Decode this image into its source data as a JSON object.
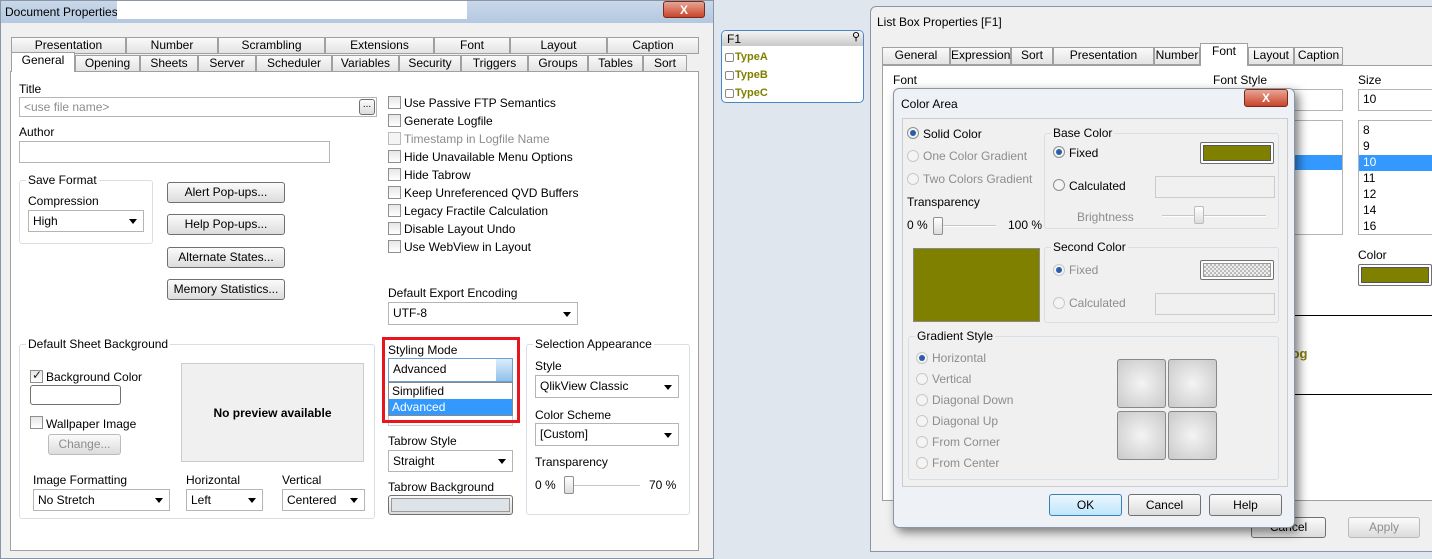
{
  "doc": {
    "title": "Document Properties",
    "close": "X",
    "tabs_row1": [
      "Presentation",
      "Number",
      "Scrambling",
      "Extensions",
      "Font",
      "Layout",
      "Caption"
    ],
    "tabs_row2": [
      "General",
      "Opening",
      "Sheets",
      "Server",
      "Scheduler",
      "Variables",
      "Security",
      "Triggers",
      "Groups",
      "Tables",
      "Sort"
    ],
    "title_label": "Title",
    "title_placeholder": "<use file name>",
    "browse": "...",
    "author_label": "Author",
    "save_format": "Save Format",
    "compression_label": "Compression",
    "compression": "High",
    "buttons": [
      "Alert Pop-ups...",
      "Help Pop-ups...",
      "Alternate States...",
      "Memory Statistics..."
    ],
    "checks": [
      {
        "label": "Use Passive FTP Semantics",
        "checked": false,
        "disabled": false
      },
      {
        "label": "Generate Logfile",
        "checked": false,
        "disabled": false
      },
      {
        "label": "Timestamp in Logfile Name",
        "checked": false,
        "disabled": true
      },
      {
        "label": "Hide Unavailable Menu Options",
        "checked": false,
        "disabled": false
      },
      {
        "label": "Hide Tabrow",
        "checked": false,
        "disabled": false
      },
      {
        "label": "Keep Unreferenced QVD Buffers",
        "checked": false,
        "disabled": false
      },
      {
        "label": "Legacy Fractile Calculation",
        "checked": false,
        "disabled": false
      },
      {
        "label": "Disable Layout Undo",
        "checked": false,
        "disabled": false
      },
      {
        "label": "Use WebView in Layout",
        "checked": false,
        "disabled": false
      }
    ],
    "export_label": "Default Export Encoding",
    "export": "UTF-8",
    "sheet_bg": "Default Sheet Background",
    "bg_color": "Background Color",
    "wallpaper": "Wallpaper Image",
    "change": "Change...",
    "no_preview": "No preview available",
    "img_fmt_label": "Image Formatting",
    "img_fmt": "No Stretch",
    "horiz_label": "Horizontal",
    "horiz": "Left",
    "vert_label": "Vertical",
    "vert": "Centered",
    "styling_label": "Styling Mode",
    "styling": "Advanced",
    "styling_options": [
      "Simplified",
      "Advanced"
    ],
    "tabrow_style_label": "Tabrow Style",
    "tabrow_style": "Straight",
    "tabrow_bg_label": "Tabrow Background",
    "sel_app": "Selection Appearance",
    "style_label": "Style",
    "style": "QlikView Classic",
    "scheme_label": "Color Scheme",
    "scheme": "[Custom]",
    "transp_label": "Transparency",
    "transp_min": "0 %",
    "transp_max": "70 %",
    "transp_value": 0
  },
  "listbox": {
    "title": "F1",
    "search_icon": "search-icon",
    "items": [
      "TypeA",
      "TypeB",
      "TypeC"
    ],
    "item_color": "#7f7f00"
  },
  "lbp": {
    "title": "List Box Properties [F1]",
    "tabs": [
      "General",
      "Expressions",
      "Sort",
      "Presentation",
      "Number",
      "Font",
      "Layout",
      "Caption"
    ],
    "font_label": "Font",
    "style_label": "Font Style",
    "size_label": "Size",
    "size": "10",
    "sizes": [
      "8",
      "9",
      "10",
      "11",
      "12",
      "14",
      "16"
    ],
    "size_selected": "10",
    "color_label": "Color",
    "color": "#808000",
    "sample": "log",
    "cancel": "Cancel",
    "apply": "Apply"
  },
  "ca": {
    "title": "Color Area",
    "close": "X",
    "solid": "Solid Color",
    "one_grad": "One Color Gradient",
    "two_grad": "Two Colors Gradient",
    "transp": "Transparency",
    "t_min": "0 %",
    "t_max": "100 %",
    "transp_value": 0,
    "base": "Base Color",
    "fixed": "Fixed",
    "calculated": "Calculated",
    "brightness": "Brightness",
    "second": "Second Color",
    "fixed2": "Fixed",
    "calculated2": "Calculated",
    "grad_style": "Gradient Style",
    "grad_options": [
      "Horizontal",
      "Vertical",
      "Diagonal Down",
      "Diagonal Up",
      "From Corner",
      "From Center"
    ],
    "ok": "OK",
    "cancel": "Cancel",
    "help": "Help",
    "base_color": "#808000"
  }
}
